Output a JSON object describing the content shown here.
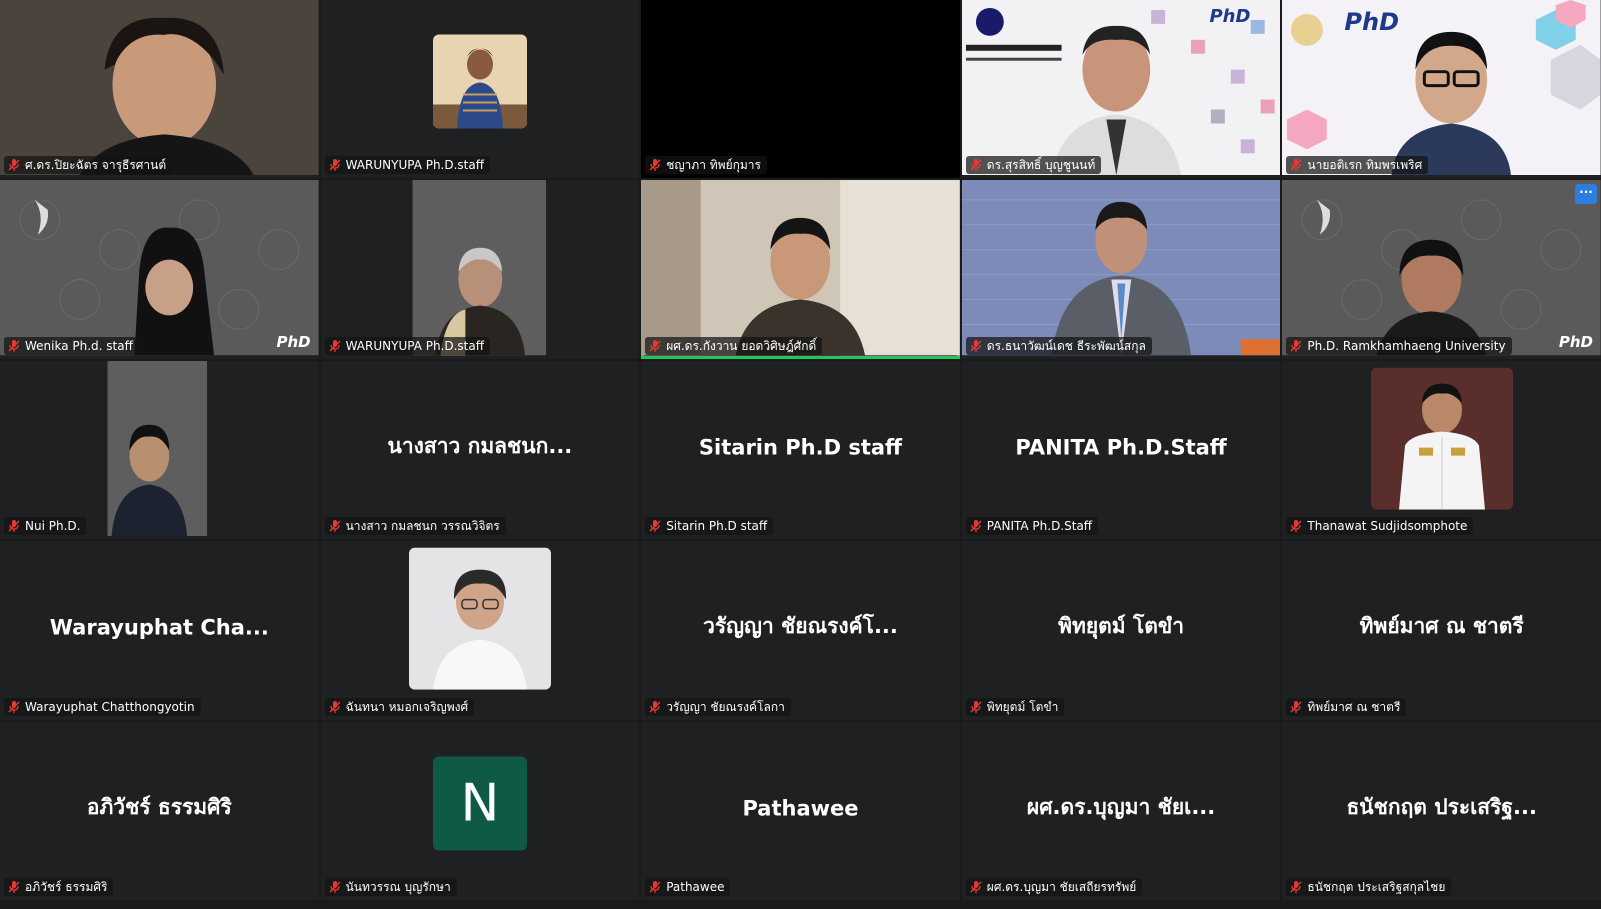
{
  "meeting": {
    "participants": [
      {
        "name": "ศ.ดร.ปิยะฉัตร จารุธีรศานต์",
        "big_name": "",
        "video": "on"
      },
      {
        "name": "WARUNYUPA Ph.D.staff",
        "big_name": "",
        "video": "photo"
      },
      {
        "name": "ชญาภา ทิพย์กุมาร",
        "big_name": "",
        "video": "black"
      },
      {
        "name": "ดร.สุรสิทธิ์ บุญชูนนท์",
        "big_name": "",
        "video": "on",
        "banner_text": "PhD"
      },
      {
        "name": "นายอติเรก ทิมพรเพริศ",
        "big_name": "",
        "video": "on",
        "banner_text": "PhD"
      },
      {
        "name": "Wenika Ph.d. staff",
        "big_name": "",
        "video": "on",
        "banner_text": "PhD"
      },
      {
        "name": "WARUNYUPA Ph.D.staff",
        "big_name": "",
        "video": "on"
      },
      {
        "name": "ผศ.ดร.กังวาน ยอดวิศิษฎ์ศักดิ์",
        "big_name": "",
        "video": "on",
        "active": true
      },
      {
        "name": "ดร.ธนาวัฒน์เดช ธีระพัฒน์สกุล",
        "big_name": "",
        "video": "on"
      },
      {
        "name": "Ph.D. Ramkhamhaeng University",
        "big_name": "",
        "video": "on",
        "banner_text": "PhD",
        "more_label": "···"
      },
      {
        "name": "Nui Ph.D.",
        "big_name": "",
        "video": "on"
      },
      {
        "name": "นางสาว กมลชนก วรรณวิจิตร",
        "big_name": "นางสาว กมลชนก...",
        "video": "off"
      },
      {
        "name": "Sitarin Ph.D staff",
        "big_name": "Sitarin Ph.D staff",
        "video": "off"
      },
      {
        "name": "PANITA Ph.D.Staff",
        "big_name": "PANITA Ph.D.Staff",
        "video": "off"
      },
      {
        "name": "Thanawat Sudjidsomphote",
        "big_name": "",
        "video": "photo"
      },
      {
        "name": "Warayuphat Chatthongyotin",
        "big_name": "Warayuphat Cha...",
        "video": "off"
      },
      {
        "name": "ฉันทนา หมอกเจริญพงศ์",
        "big_name": "",
        "video": "photo"
      },
      {
        "name": "วรัญญา ชัยณรงค์โลกา",
        "big_name": "วรัญญา ชัยณรงค์โ...",
        "video": "off"
      },
      {
        "name": "พิทยุตม์ โตขำ",
        "big_name": "พิทยุตม์ โตขำ",
        "video": "off"
      },
      {
        "name": "ทิพย์มาศ ณ ชาตรี",
        "big_name": "ทิพย์มาศ ณ ชาตรี",
        "video": "off"
      },
      {
        "name": "อภิวัชร์ ธรรมศิริ",
        "big_name": "อภิวัชร์ ธรรมศิริ",
        "video": "off"
      },
      {
        "name": "นันทวรรณ บุญรักษา",
        "big_name": "",
        "video": "initial",
        "initial": "N"
      },
      {
        "name": "Pathawee",
        "big_name": "Pathawee",
        "video": "off"
      },
      {
        "name": "ผศ.ดร.บุญมา ชัยเสถียรทรัพย์",
        "big_name": "ผศ.ดร.บุญมา ชัยเ...",
        "video": "off"
      },
      {
        "name": "ธนัชกฤต ประเสริฐสกุลไชย",
        "big_name": "ธนัชกฤต ประเสริฐ...",
        "video": "off"
      }
    ]
  },
  "colors": {
    "background": "#1a1a1a",
    "tile": "#1f2022",
    "active_border": "#22c55e",
    "mute_icon": "#e53935",
    "avatar_green": "#0f5a46"
  }
}
